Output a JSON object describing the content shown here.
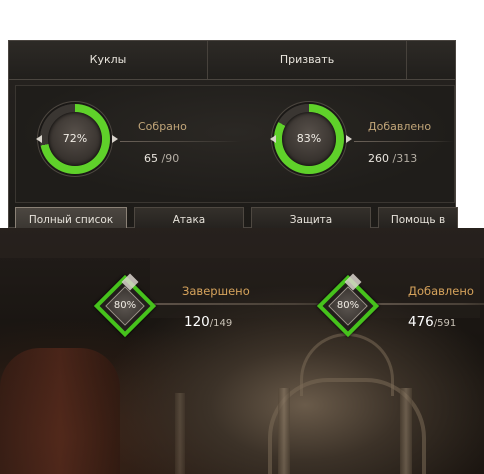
{
  "tabs": [
    {
      "label": "Куклы"
    },
    {
      "label": "Призвать"
    }
  ],
  "top_stats": [
    {
      "percent_label": "72%",
      "progress": 72,
      "label": "Собрано",
      "value": "65",
      "total": "/90"
    },
    {
      "percent_label": "83%",
      "progress": 83,
      "label": "Добавлено",
      "value": "260",
      "total": "/313"
    }
  ],
  "filter_buttons": [
    {
      "label": "Полный список",
      "active": true
    },
    {
      "label": "Атака",
      "active": false
    },
    {
      "label": "Защита",
      "active": false
    },
    {
      "label": "Помощь в",
      "active": false
    }
  ],
  "bottom_stats": [
    {
      "percent_label": "80%",
      "progress": 80,
      "label": "Завершено",
      "value": "120",
      "total": "/149"
    },
    {
      "percent_label": "80%",
      "progress": 80,
      "label": "Добавлено",
      "value": "476",
      "total": "/591"
    }
  ],
  "colors": {
    "progress_green": "#5fd12a",
    "track": "#3a3632",
    "label_gold": "#c2a679",
    "label_orange": "#d6a35c"
  }
}
